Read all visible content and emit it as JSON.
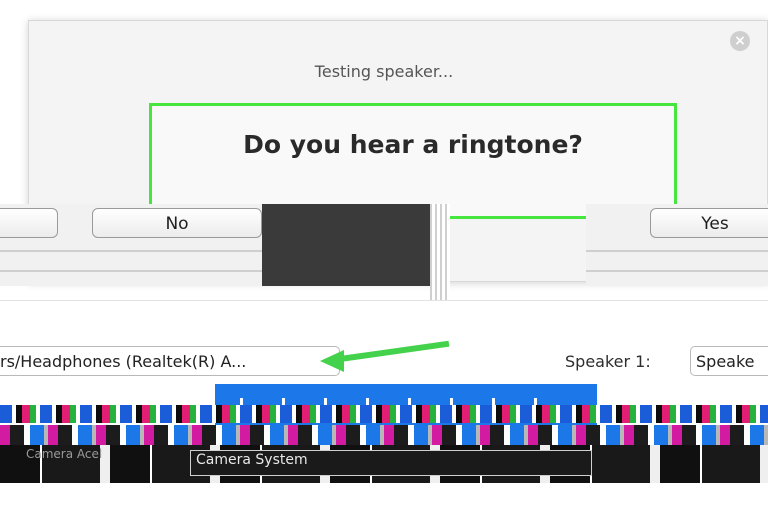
{
  "dialog": {
    "status_text": "Testing speaker...",
    "prompt": "Do you hear a ringtone?",
    "close_icon": "close-icon"
  },
  "answers": {
    "no_label": "No",
    "yes_label": "Yes"
  },
  "settings": {
    "device_value": "rs/Headphones (Realtek(R) A...",
    "speaker_label": "Speaker 1:",
    "speaker_value": "Speake"
  },
  "glitch": {
    "lower_label": "Camera Acel",
    "input_value": "Camera System"
  },
  "colors": {
    "highlight_border": "#46e63f",
    "arrow": "#44d14b",
    "accent_blue": "#1c78e8"
  }
}
